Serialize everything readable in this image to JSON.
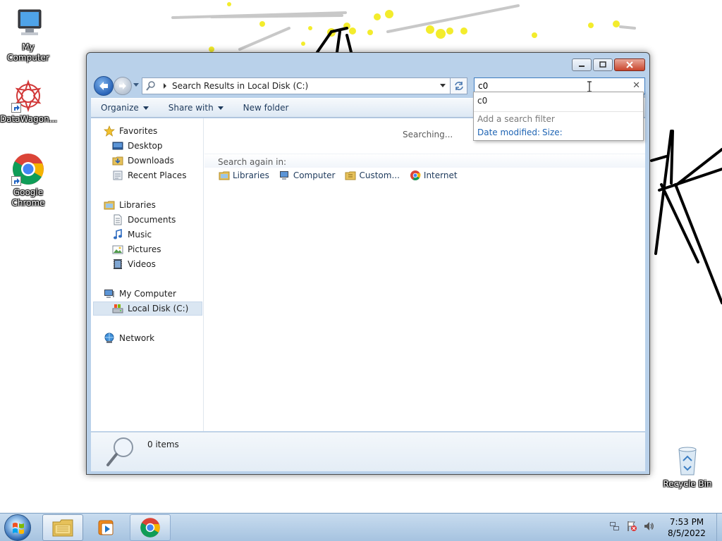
{
  "desktop": {
    "icons": [
      {
        "label": "My Computer",
        "icon": "my-computer-icon"
      },
      {
        "label": "DataWagon...",
        "icon": "datawagon-icon"
      },
      {
        "label": "Google Chrome",
        "icon": "chrome-icon"
      },
      {
        "label": "Recycle Bin",
        "icon": "recycle-bin-icon"
      }
    ]
  },
  "window": {
    "address": {
      "breadcrumb": "Search Results in Local Disk (C:)"
    },
    "search": {
      "value": "c0"
    },
    "commands": {
      "organize": "Organize",
      "share_with": "Share with",
      "new_folder": "New folder"
    },
    "nav": {
      "favorites": "Favorites",
      "desktop": "Desktop",
      "downloads": "Downloads",
      "recent_places": "Recent Places",
      "libraries": "Libraries",
      "documents": "Documents",
      "music": "Music",
      "pictures": "Pictures",
      "videos": "Videos",
      "my_computer": "My Computer",
      "local_disk": "Local Disk (C:)",
      "network": "Network"
    },
    "results": {
      "status": "Searching...",
      "search_again_label": "Search again in:",
      "search_again_links": {
        "libraries": "Libraries",
        "computer": "Computer",
        "custom": "Custom...",
        "internet": "Internet"
      }
    },
    "details": {
      "item_count": "0 items"
    }
  },
  "search_dropdown": {
    "suggestion": "c0",
    "filter_hint": "Add a search filter",
    "filter_date": "Date modified:",
    "filter_size": "Size:"
  },
  "taskbar": {
    "time": "7:53 PM",
    "date": "8/5/2022"
  },
  "colors": {
    "window_frame": "#b9d1ea",
    "link_blue": "#1e64b4",
    "selection": "#dae6f2",
    "taskbar": "#a6c3e0"
  }
}
